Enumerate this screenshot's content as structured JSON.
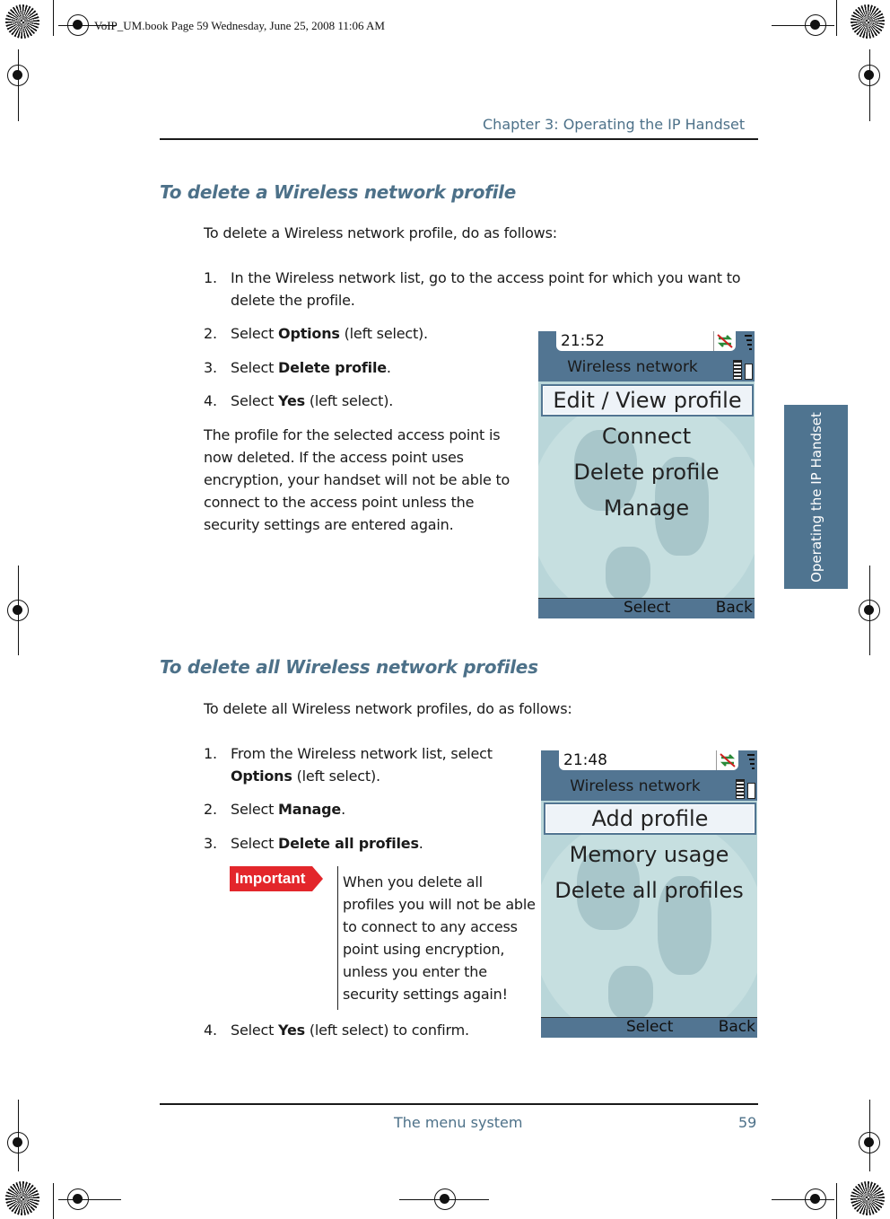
{
  "print_stamp": "VoIP_UM.book  Page 59  Wednesday, June 25, 2008  11:06 AM",
  "header": {
    "chapter": "Chapter 3:  Operating the IP Handset"
  },
  "side_tab": "Operating the IP Handset",
  "section1": {
    "heading": "To delete a Wireless network profile",
    "intro": "To delete a Wireless network profile, do as follows:",
    "steps": [
      {
        "num": "1.",
        "text": "In the Wireless network list, go to the access point for which you want to",
        "text2": "delete the profile."
      },
      {
        "num": "2.",
        "pre": "Select ",
        "bold": "Options",
        "post": " (left select)."
      },
      {
        "num": "3.",
        "pre": "Select ",
        "bold": "Delete profile",
        "post": "."
      },
      {
        "num": "4.",
        "pre": "Select ",
        "bold": "Yes",
        "post": " (left select)."
      }
    ],
    "result_lines": [
      "The profile for the selected access point is",
      "now deleted. If the access point uses",
      "encryption, your handset will not be able to",
      "connect to the access point unless the",
      "security settings are entered again."
    ],
    "screen": {
      "time": "21:52",
      "title": "Wireless network",
      "selected": "Edit / View profile",
      "items": [
        "Connect",
        "Delete profile",
        "Manage"
      ],
      "softkey_left": "Select",
      "softkey_right": "Back",
      "icons": [
        "no-connection-icon",
        "signal-icon",
        "battery-icon",
        "handset-icon"
      ]
    }
  },
  "section2": {
    "heading": "To delete all Wireless network profiles",
    "intro": "To delete all Wireless network profiles, do as follows:",
    "steps": [
      {
        "num": "1.",
        "text": "From the Wireless network list, select",
        "bold2": "Options",
        "post2": " (left select)."
      },
      {
        "num": "2.",
        "pre": "Select ",
        "bold": "Manage",
        "post": "."
      },
      {
        "num": "3.",
        "pre": "Select ",
        "bold": "Delete all profiles",
        "post": "."
      },
      {
        "num": "4.",
        "pre": "Select ",
        "bold": "Yes",
        "post": " (left select) to confirm."
      }
    ],
    "important_label": "Important",
    "important_lines": [
      "When you delete all",
      "profiles you will not be able",
      "to connect to any access",
      "point using encryption,",
      "unless you enter the",
      "security settings again!"
    ],
    "screen": {
      "time": "21:48",
      "title": "Wireless network",
      "selected": "Add profile",
      "items": [
        "Memory usage",
        "Delete all profiles"
      ],
      "softkey_left": "Select",
      "softkey_right": "Back"
    }
  },
  "footer": {
    "section": "The menu system",
    "page": "59"
  },
  "colors": {
    "accent": "#4d7189",
    "tab": "#4f7490",
    "important": "#e3262b",
    "screen_bar": "#527592",
    "screen_bg": "#b9d6d9"
  }
}
